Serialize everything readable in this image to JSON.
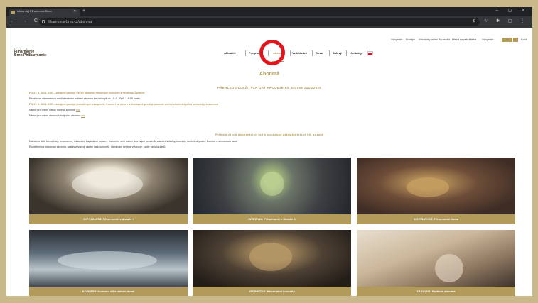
{
  "browser": {
    "tab_title": "Abonmá | Filharmonie Brno",
    "new_tab": "+",
    "window_controls": "– ▢ ✕",
    "nav_buttons": "← → C",
    "url": "filharmonie-brno.cz/abonma",
    "toolbar_icons": "⊕ ☆ ✱ ▢ ⋮"
  },
  "utility_nav": [
    {
      "label": "Vstupenky"
    },
    {
      "label": "Prodejní"
    },
    {
      "label": "Vstupenky online"
    },
    {
      "label": "Pro média"
    },
    {
      "label": "Hledat na webu"
    },
    {
      "label": "Hledat"
    },
    {
      "label": "Vstupenky"
    },
    {
      "label": "Košík"
    }
  ],
  "logo": {
    "dots": "• • •",
    "line1": "Filharmonie",
    "line2": "Brno Philharmonic"
  },
  "main_nav": [
    {
      "label": "Aktuality"
    },
    {
      "label": "Program"
    },
    {
      "label": "Abonmá"
    },
    {
      "label": "Vzdělávání"
    },
    {
      "label": "O nás"
    },
    {
      "label": "Sálový"
    },
    {
      "label": "Kontakty"
    }
  ],
  "page": {
    "title": "Abonmá",
    "overview_heading": "PŘEHLED DŮLEŽITÝCH DAT PRODEJE 60. sezony 2024/2025",
    "line1": "PO 27. 5. 2024, 9:00 – zahájení prodeje všech abonmá, Hlasových koncertů a Festivalu Špilberk",
    "line2": "Rezervace abonentních míst/abonentní rodinné abonmá lze zakoupit do 14. 6. 2024 · 18:00 hodin.",
    "line3": "PO 17. 6. 2024, 9:00 – zahájení prodeje jednotlivých vstupenek, Koncert na míru a jednorázové prodeje abonmá včetně studentských a seniorských abonmá",
    "line4_text": "Návod pro online nákup nového abonmá",
    "line4_link": "zde",
    "line5_text": "Návod pro online obnovu stávajícího abonmá",
    "line5_link": "zde",
    "intro_heading": "Přehled všech abonentních řad v současné předplatitelské 60. sezoně",
    "intro_line1": "Nabízíme širší formu řady: Impozantní, Inkvizivní, Inspirativní koncert. Koncertní sérii menší sborových koncertů, sakrální skladby, koncerty rodiček obyvatel, Komfort a seniorskou řadu.",
    "intro_line2": "Rozdělení na plánovaní abonmá, sestavte si svoji vlastní řadu koncertů, která vám nejlépe vyhovuje, podle vašich zájmů."
  },
  "cards": [
    {
      "label": "IMPOZANTNÍ: Filharmonie v divadle I"
    },
    {
      "label": "INVEZIVNÍ: Filharmonie v divadle II"
    },
    {
      "label": "INSPIRATIVNÍ: Filharmonie doma"
    },
    {
      "label": "KOMORNÍ: Komorní v Besedním domě"
    },
    {
      "label": "JEDINEČNÁ: Mimořádné koncerty"
    },
    {
      "label": "ZÁBAVNÁ: Rodinná abonmá"
    }
  ],
  "colors": {
    "accent": "#b19a5a",
    "highlight_ring": "#e3151c"
  }
}
